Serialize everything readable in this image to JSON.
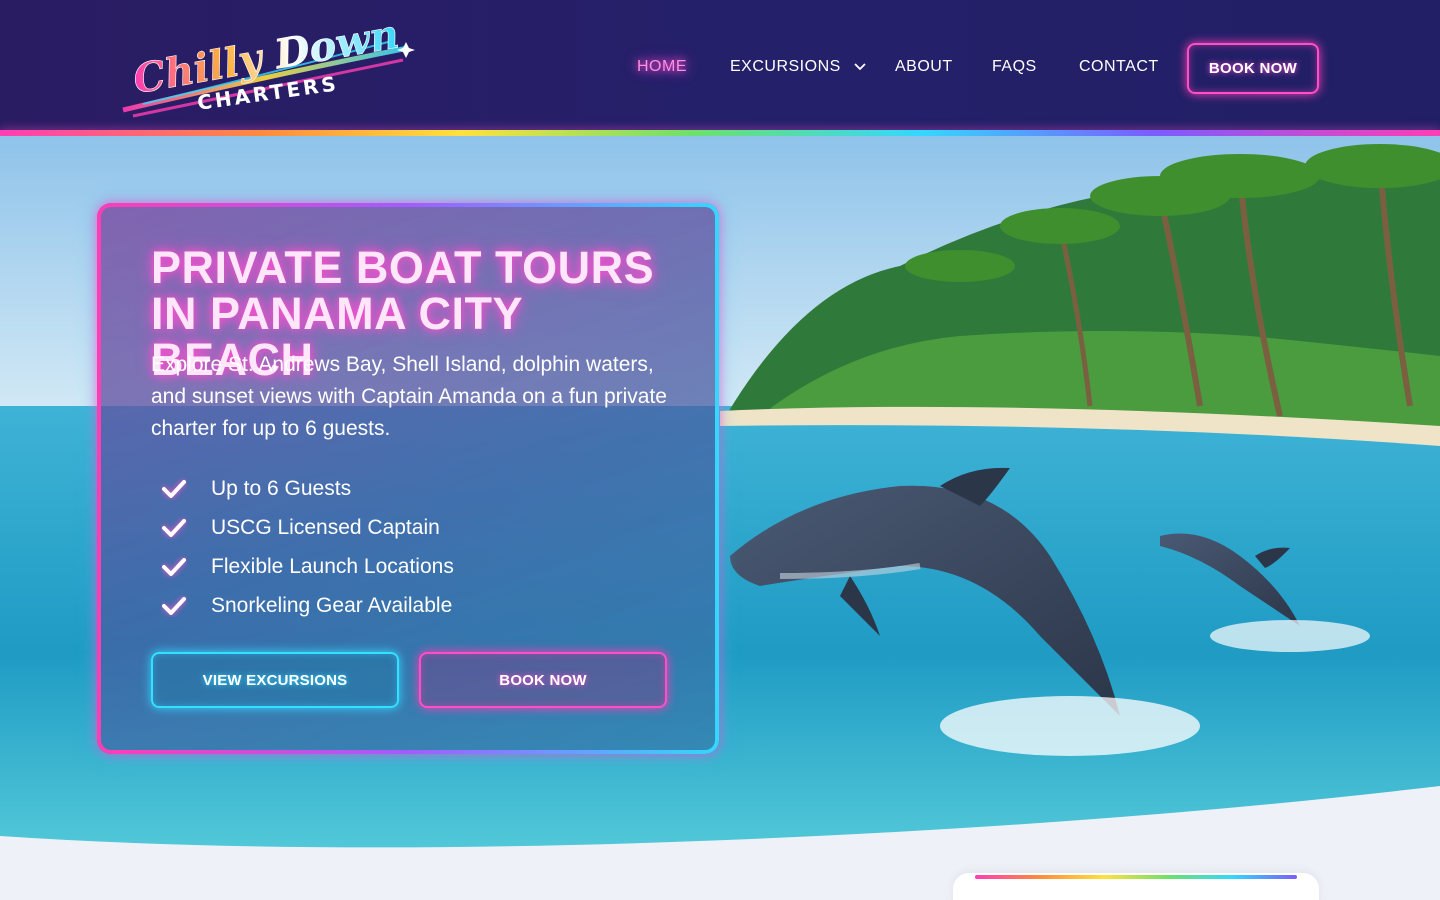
{
  "brand": {
    "logo_line1": "Chilly Down",
    "logo_line2": "CHARTERS"
  },
  "nav": {
    "home": "HOME",
    "excursions": "EXCURSIONS",
    "about": "ABOUT",
    "faqs": "FAQS",
    "contact": "CONTACT",
    "book_now": "BOOK NOW"
  },
  "hero": {
    "title": "PRIVATE BOAT TOURS IN PANAMA CITY BEACH",
    "description": "Explore St. Andrews Bay, Shell Island, dolphin waters, and sunset views with Captain Amanda on a fun private charter for up to 6 guests.",
    "features": [
      "Up to 6 Guests",
      "USCG Licensed Captain",
      "Flexible Launch Locations",
      "Snorkeling Gear Available"
    ],
    "view_excursions": "VIEW EXCURSIONS",
    "book_now": "BOOK NOW"
  },
  "colors": {
    "header_bg": "#2a1c63",
    "neon_pink": "#ff3db4",
    "neon_cyan": "#33d8ff"
  }
}
